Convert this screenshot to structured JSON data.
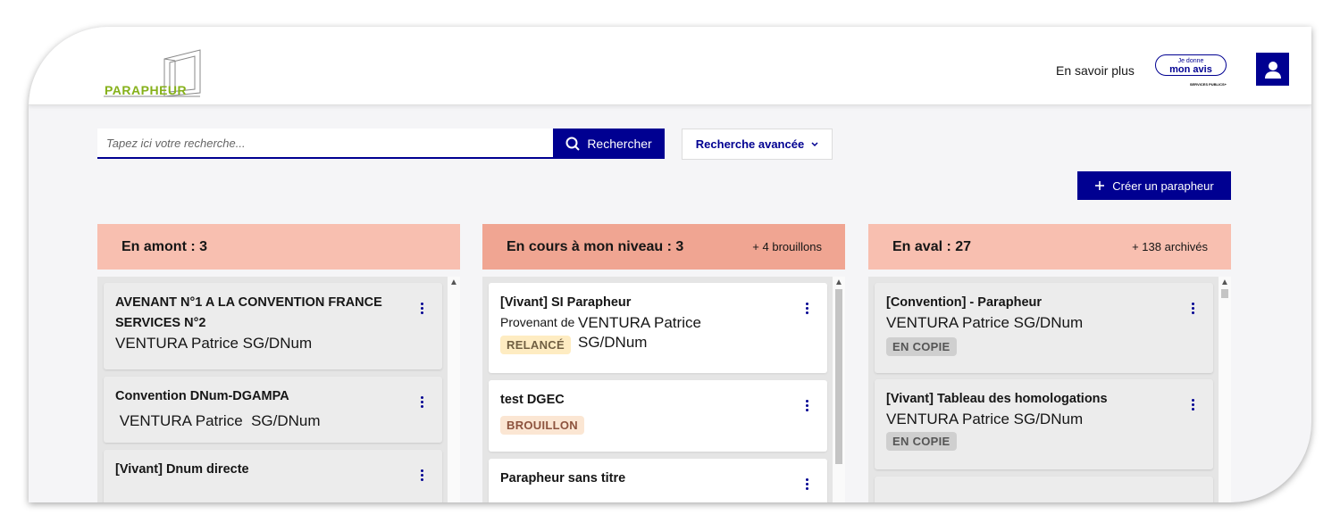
{
  "header": {
    "logo_text": "PARAPHEUR",
    "link_label": "En savoir plus",
    "avis_small": "Je donne",
    "avis_big": "mon avis",
    "avis_brand": "SERVICES PUBLICS+",
    "account_icon": "user-icon"
  },
  "search": {
    "placeholder": "Tapez ici votre recherche...",
    "button_label": "Rechercher",
    "advanced_label": "Recherche avancée",
    "create_label": "Créer un parapheur"
  },
  "columns": [
    {
      "title": "En amont : 3",
      "extra": "",
      "color": "#f8bfb0",
      "cards": [
        {
          "title": "AVENANT N°1 A LA CONVENTION FRANCE SERVICES N°2",
          "person": "VENTURA Patrice  SG/DNum"
        },
        {
          "title": "Convention DNum-DGAMPA",
          "person": " VENTURA Patrice  SG/DNum"
        },
        {
          "title": "[Vivant] Dnum directe",
          "person": ""
        }
      ]
    },
    {
      "title": "En cours à mon niveau : 3",
      "extra": "+ 4 brouillons",
      "color": "#f0a592",
      "cards": [
        {
          "title": "[Vivant] SI Parapheur",
          "provenant": "Provenant de",
          "person_line1": "VENTURA Patrice",
          "person_line2": "SG/DNum",
          "badge": "RELANCÉ"
        },
        {
          "title": "test DGEC",
          "badge": "BROUILLON"
        },
        {
          "title": "Parapheur sans titre"
        }
      ]
    },
    {
      "title": "En aval : 27",
      "extra": "+ 138 archivés",
      "color": "#f8bfb0",
      "cards": [
        {
          "title": "[Convention] - Parapheur",
          "person": "VENTURA Patrice  SG/DNum",
          "badge": "EN COPIE"
        },
        {
          "title": "[Vivant] Tableau des homologations",
          "person": "VENTURA Patrice  SG/DNum",
          "badge": "EN COPIE"
        }
      ]
    }
  ],
  "colors": {
    "primary": "#000091",
    "logo_green": "#86b11b"
  }
}
